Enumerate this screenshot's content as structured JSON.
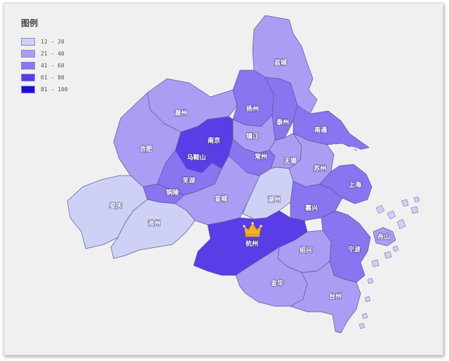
{
  "legend": {
    "title": "图例",
    "items": [
      {
        "label": "12 - 20",
        "color": "#cfd0f6"
      },
      {
        "label": "21 - 40",
        "color": "#a99ef3"
      },
      {
        "label": "41 - 60",
        "color": "#8a74f0"
      },
      {
        "label": "61 - 80",
        "color": "#5a3de6"
      },
      {
        "label": "81 - 100",
        "color": "#1a10d8"
      }
    ]
  },
  "cities": [
    {
      "id": "yancheng",
      "name": "盐城",
      "range": 1
    },
    {
      "id": "chuzhou",
      "name": "滁州",
      "range": 1
    },
    {
      "id": "yangzhou",
      "name": "扬州",
      "range": 2
    },
    {
      "id": "taizhou-js",
      "name": "泰州",
      "range": 2
    },
    {
      "id": "nantong",
      "name": "南通",
      "range": 2
    },
    {
      "id": "hefei",
      "name": "合肥",
      "range": 1
    },
    {
      "id": "nanjing",
      "name": "南京",
      "range": 3
    },
    {
      "id": "zhenjiang",
      "name": "镇江",
      "range": 1
    },
    {
      "id": "maanshan",
      "name": "马鞍山",
      "range": 3
    },
    {
      "id": "changzhou",
      "name": "常州",
      "range": 2
    },
    {
      "id": "wuxi",
      "name": "无锡",
      "range": 1
    },
    {
      "id": "suzhou",
      "name": "苏州",
      "range": 1
    },
    {
      "id": "wuhu",
      "name": "芜湖",
      "range": 2
    },
    {
      "id": "tongling",
      "name": "铜陵",
      "range": 2
    },
    {
      "id": "anqing",
      "name": "安庆",
      "range": 0
    },
    {
      "id": "xuancheng",
      "name": "宣城",
      "range": 1
    },
    {
      "id": "huzhou",
      "name": "湖州",
      "range": 0
    },
    {
      "id": "shanghai",
      "name": "上海",
      "range": 2
    },
    {
      "id": "jiaxing",
      "name": "嘉兴",
      "range": 2
    },
    {
      "id": "chizhou",
      "name": "池州",
      "range": 0
    },
    {
      "id": "hangzhou",
      "name": "杭州",
      "range": 3
    },
    {
      "id": "shaoxing",
      "name": "绍兴",
      "range": 1
    },
    {
      "id": "ningbo",
      "name": "宁波",
      "range": 2
    },
    {
      "id": "zhoushan",
      "name": "舟山",
      "range": 1
    },
    {
      "id": "jinhua",
      "name": "金华",
      "range": 1
    },
    {
      "id": "taizhou-zj",
      "name": "台州",
      "range": 1
    }
  ],
  "highlight": {
    "city": "hangzhou",
    "icon": "crown-icon",
    "color": "#f2b230"
  }
}
